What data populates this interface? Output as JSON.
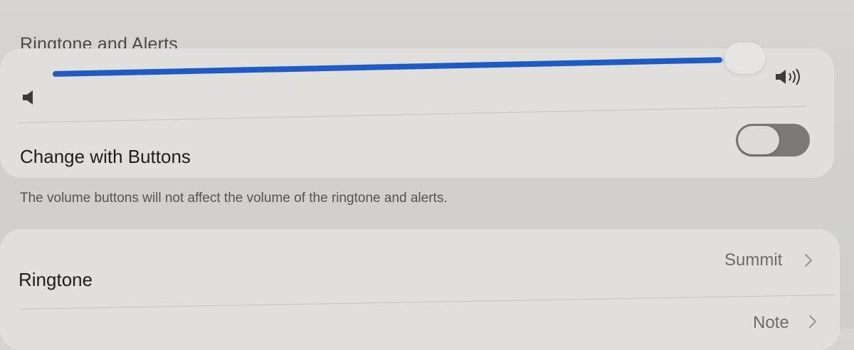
{
  "section": {
    "title": "Ringtone and Alerts"
  },
  "volume_slider": {
    "level": 0.96,
    "low_icon": "speaker-low-icon",
    "high_icon": "speaker-high-icon",
    "fill_color": "#1d5bc7"
  },
  "change_with_buttons": {
    "label": "Change with Buttons",
    "state": "off",
    "footnote": "The volume buttons will not affect the volume of the ringtone and alerts."
  },
  "sounds": {
    "rows": [
      {
        "label": "Ringtone",
        "value": "Summit",
        "icon": "chevron-right-icon"
      },
      {
        "label": "",
        "value": "Note",
        "icon": "chevron-right-icon"
      }
    ]
  }
}
